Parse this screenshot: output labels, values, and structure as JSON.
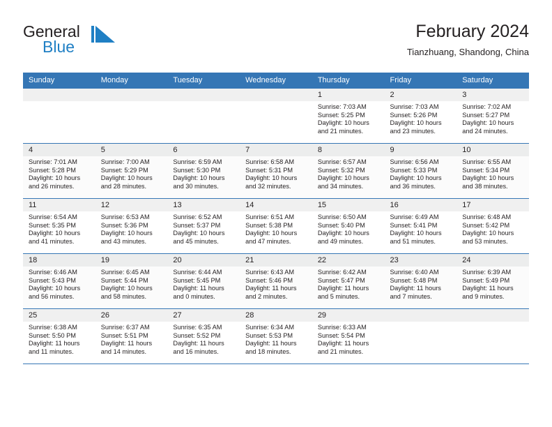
{
  "brand": {
    "name_part1": "General",
    "name_part2": "Blue",
    "mark": "triangle-flag-logo"
  },
  "header": {
    "title": "February 2024",
    "subtitle": "Tianzhuang, Shandong, China"
  },
  "calendar": {
    "weekday_headers": [
      "Sunday",
      "Monday",
      "Tuesday",
      "Wednesday",
      "Thursday",
      "Friday",
      "Saturday"
    ],
    "colors": {
      "header_blue": "#3576b5",
      "brand_blue": "#1f7fc4",
      "daynum_band": "#f0f0f0",
      "text": "#231f20",
      "row_shaded": "#fbfbfb"
    },
    "weeks": [
      {
        "shaded": false,
        "days": [
          {
            "day": "",
            "sunrise": "",
            "sunset": "",
            "daylight1": "",
            "daylight2": ""
          },
          {
            "day": "",
            "sunrise": "",
            "sunset": "",
            "daylight1": "",
            "daylight2": ""
          },
          {
            "day": "",
            "sunrise": "",
            "sunset": "",
            "daylight1": "",
            "daylight2": ""
          },
          {
            "day": "",
            "sunrise": "",
            "sunset": "",
            "daylight1": "",
            "daylight2": ""
          },
          {
            "day": "1",
            "sunrise": "Sunrise: 7:03 AM",
            "sunset": "Sunset: 5:25 PM",
            "daylight1": "Daylight: 10 hours",
            "daylight2": "and 21 minutes."
          },
          {
            "day": "2",
            "sunrise": "Sunrise: 7:03 AM",
            "sunset": "Sunset: 5:26 PM",
            "daylight1": "Daylight: 10 hours",
            "daylight2": "and 23 minutes."
          },
          {
            "day": "3",
            "sunrise": "Sunrise: 7:02 AM",
            "sunset": "Sunset: 5:27 PM",
            "daylight1": "Daylight: 10 hours",
            "daylight2": "and 24 minutes."
          }
        ]
      },
      {
        "shaded": true,
        "days": [
          {
            "day": "4",
            "sunrise": "Sunrise: 7:01 AM",
            "sunset": "Sunset: 5:28 PM",
            "daylight1": "Daylight: 10 hours",
            "daylight2": "and 26 minutes."
          },
          {
            "day": "5",
            "sunrise": "Sunrise: 7:00 AM",
            "sunset": "Sunset: 5:29 PM",
            "daylight1": "Daylight: 10 hours",
            "daylight2": "and 28 minutes."
          },
          {
            "day": "6",
            "sunrise": "Sunrise: 6:59 AM",
            "sunset": "Sunset: 5:30 PM",
            "daylight1": "Daylight: 10 hours",
            "daylight2": "and 30 minutes."
          },
          {
            "day": "7",
            "sunrise": "Sunrise: 6:58 AM",
            "sunset": "Sunset: 5:31 PM",
            "daylight1": "Daylight: 10 hours",
            "daylight2": "and 32 minutes."
          },
          {
            "day": "8",
            "sunrise": "Sunrise: 6:57 AM",
            "sunset": "Sunset: 5:32 PM",
            "daylight1": "Daylight: 10 hours",
            "daylight2": "and 34 minutes."
          },
          {
            "day": "9",
            "sunrise": "Sunrise: 6:56 AM",
            "sunset": "Sunset: 5:33 PM",
            "daylight1": "Daylight: 10 hours",
            "daylight2": "and 36 minutes."
          },
          {
            "day": "10",
            "sunrise": "Sunrise: 6:55 AM",
            "sunset": "Sunset: 5:34 PM",
            "daylight1": "Daylight: 10 hours",
            "daylight2": "and 38 minutes."
          }
        ]
      },
      {
        "shaded": false,
        "days": [
          {
            "day": "11",
            "sunrise": "Sunrise: 6:54 AM",
            "sunset": "Sunset: 5:35 PM",
            "daylight1": "Daylight: 10 hours",
            "daylight2": "and 41 minutes."
          },
          {
            "day": "12",
            "sunrise": "Sunrise: 6:53 AM",
            "sunset": "Sunset: 5:36 PM",
            "daylight1": "Daylight: 10 hours",
            "daylight2": "and 43 minutes."
          },
          {
            "day": "13",
            "sunrise": "Sunrise: 6:52 AM",
            "sunset": "Sunset: 5:37 PM",
            "daylight1": "Daylight: 10 hours",
            "daylight2": "and 45 minutes."
          },
          {
            "day": "14",
            "sunrise": "Sunrise: 6:51 AM",
            "sunset": "Sunset: 5:38 PM",
            "daylight1": "Daylight: 10 hours",
            "daylight2": "and 47 minutes."
          },
          {
            "day": "15",
            "sunrise": "Sunrise: 6:50 AM",
            "sunset": "Sunset: 5:40 PM",
            "daylight1": "Daylight: 10 hours",
            "daylight2": "and 49 minutes."
          },
          {
            "day": "16",
            "sunrise": "Sunrise: 6:49 AM",
            "sunset": "Sunset: 5:41 PM",
            "daylight1": "Daylight: 10 hours",
            "daylight2": "and 51 minutes."
          },
          {
            "day": "17",
            "sunrise": "Sunrise: 6:48 AM",
            "sunset": "Sunset: 5:42 PM",
            "daylight1": "Daylight: 10 hours",
            "daylight2": "and 53 minutes."
          }
        ]
      },
      {
        "shaded": true,
        "days": [
          {
            "day": "18",
            "sunrise": "Sunrise: 6:46 AM",
            "sunset": "Sunset: 5:43 PM",
            "daylight1": "Daylight: 10 hours",
            "daylight2": "and 56 minutes."
          },
          {
            "day": "19",
            "sunrise": "Sunrise: 6:45 AM",
            "sunset": "Sunset: 5:44 PM",
            "daylight1": "Daylight: 10 hours",
            "daylight2": "and 58 minutes."
          },
          {
            "day": "20",
            "sunrise": "Sunrise: 6:44 AM",
            "sunset": "Sunset: 5:45 PM",
            "daylight1": "Daylight: 11 hours",
            "daylight2": "and 0 minutes."
          },
          {
            "day": "21",
            "sunrise": "Sunrise: 6:43 AM",
            "sunset": "Sunset: 5:46 PM",
            "daylight1": "Daylight: 11 hours",
            "daylight2": "and 2 minutes."
          },
          {
            "day": "22",
            "sunrise": "Sunrise: 6:42 AM",
            "sunset": "Sunset: 5:47 PM",
            "daylight1": "Daylight: 11 hours",
            "daylight2": "and 5 minutes."
          },
          {
            "day": "23",
            "sunrise": "Sunrise: 6:40 AM",
            "sunset": "Sunset: 5:48 PM",
            "daylight1": "Daylight: 11 hours",
            "daylight2": "and 7 minutes."
          },
          {
            "day": "24",
            "sunrise": "Sunrise: 6:39 AM",
            "sunset": "Sunset: 5:49 PM",
            "daylight1": "Daylight: 11 hours",
            "daylight2": "and 9 minutes."
          }
        ]
      },
      {
        "shaded": false,
        "days": [
          {
            "day": "25",
            "sunrise": "Sunrise: 6:38 AM",
            "sunset": "Sunset: 5:50 PM",
            "daylight1": "Daylight: 11 hours",
            "daylight2": "and 11 minutes."
          },
          {
            "day": "26",
            "sunrise": "Sunrise: 6:37 AM",
            "sunset": "Sunset: 5:51 PM",
            "daylight1": "Daylight: 11 hours",
            "daylight2": "and 14 minutes."
          },
          {
            "day": "27",
            "sunrise": "Sunrise: 6:35 AM",
            "sunset": "Sunset: 5:52 PM",
            "daylight1": "Daylight: 11 hours",
            "daylight2": "and 16 minutes."
          },
          {
            "day": "28",
            "sunrise": "Sunrise: 6:34 AM",
            "sunset": "Sunset: 5:53 PM",
            "daylight1": "Daylight: 11 hours",
            "daylight2": "and 18 minutes."
          },
          {
            "day": "29",
            "sunrise": "Sunrise: 6:33 AM",
            "sunset": "Sunset: 5:54 PM",
            "daylight1": "Daylight: 11 hours",
            "daylight2": "and 21 minutes."
          },
          {
            "day": "",
            "sunrise": "",
            "sunset": "",
            "daylight1": "",
            "daylight2": ""
          },
          {
            "day": "",
            "sunrise": "",
            "sunset": "",
            "daylight1": "",
            "daylight2": ""
          }
        ]
      }
    ]
  }
}
